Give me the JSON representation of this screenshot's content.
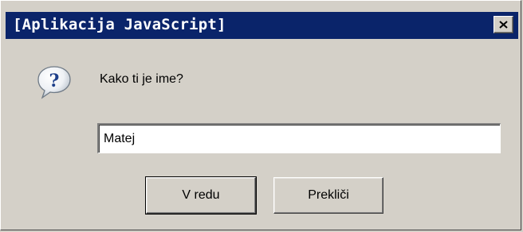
{
  "window": {
    "title": "[Aplikacija JavaScript]",
    "close_icon": "close-x-icon"
  },
  "prompt": {
    "icon": "question-balloon-icon",
    "label": "Kako ti je ime?"
  },
  "input": {
    "value": "Matej"
  },
  "buttons": {
    "ok_label": "V redu",
    "cancel_label": "Prekliči"
  },
  "colors": {
    "titlebar": "#0a246a",
    "face": "#d4d0c8",
    "title_text": "#ffffff"
  }
}
